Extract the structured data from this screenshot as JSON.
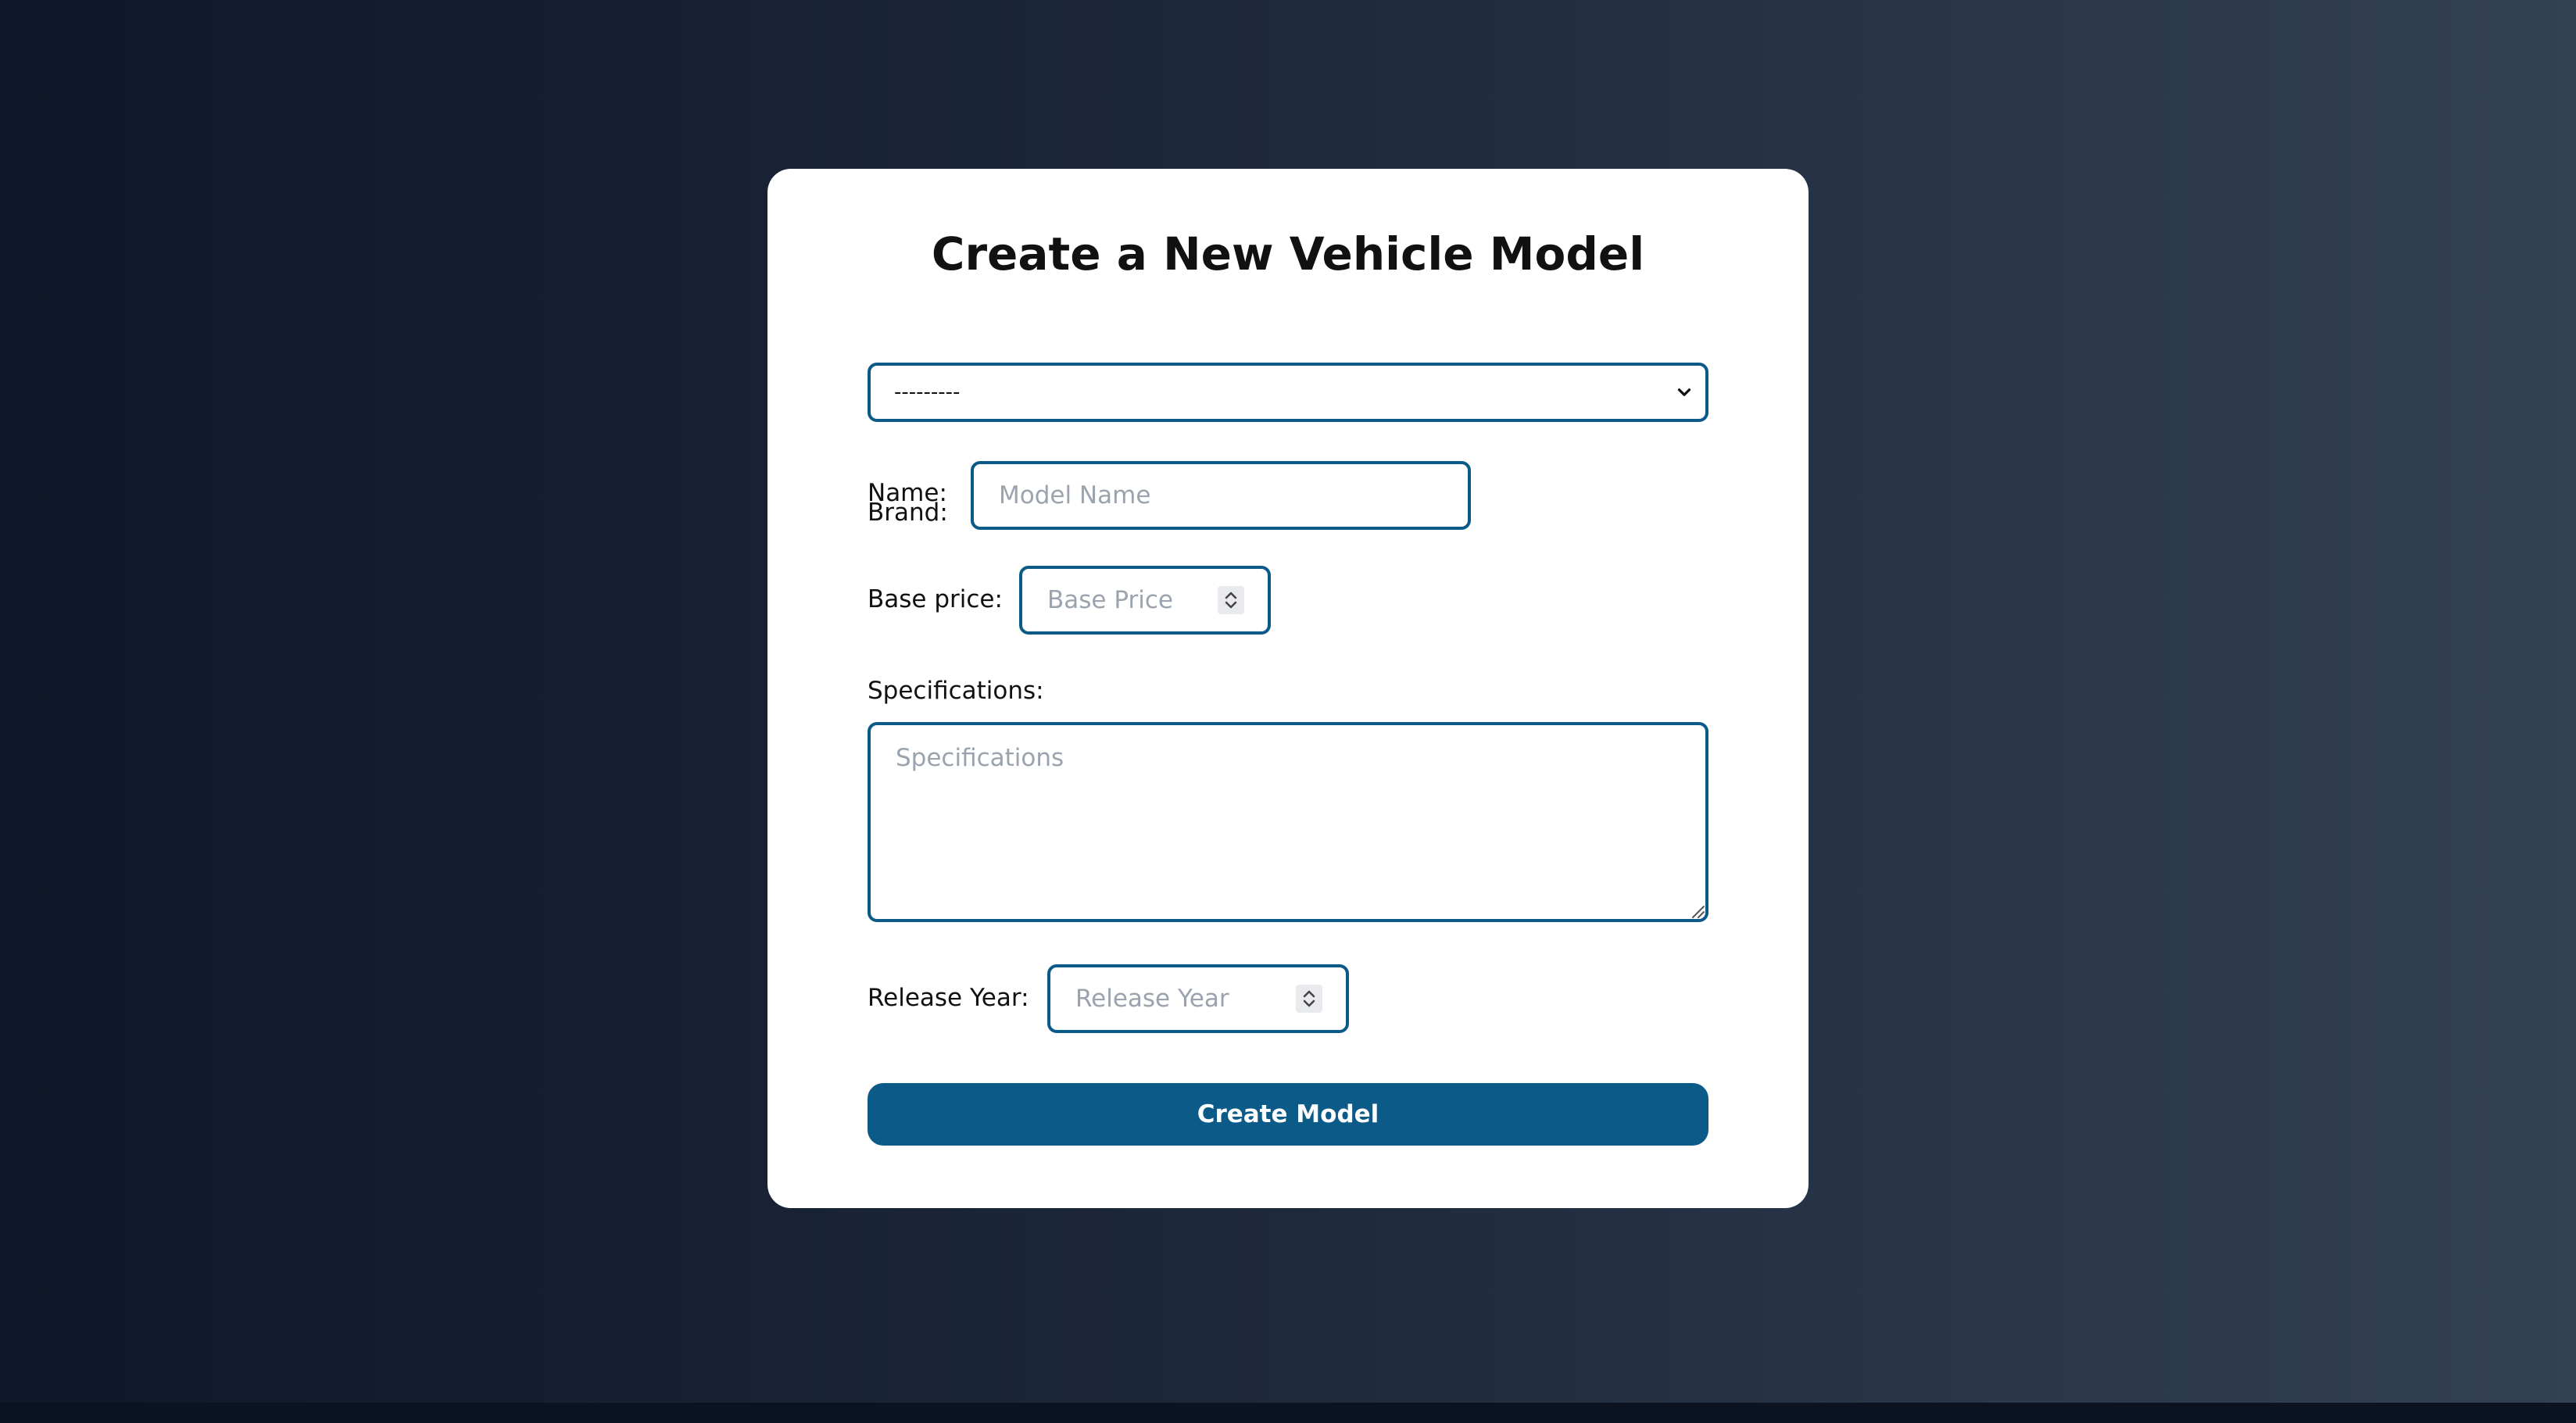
{
  "page": {
    "title": "Create a New Vehicle Model"
  },
  "form": {
    "brand": {
      "label": "Brand:",
      "selected": "---------",
      "icon": "chevron-down-icon"
    },
    "name": {
      "label": "Name:",
      "placeholder": "Model Name",
      "value": ""
    },
    "base_price": {
      "label": "Base price:",
      "placeholder": "Base Price",
      "value": ""
    },
    "specifications": {
      "label": "Specifications:",
      "placeholder": "Specifications",
      "value": ""
    },
    "release_year": {
      "label": "Release Year:",
      "placeholder": "Release Year",
      "value": ""
    },
    "submit_label": "Create Model"
  },
  "colors": {
    "accent": "#0b5a87",
    "card": "#ffffff",
    "bg_left": "#0f172a",
    "bg_right": "#334155"
  }
}
